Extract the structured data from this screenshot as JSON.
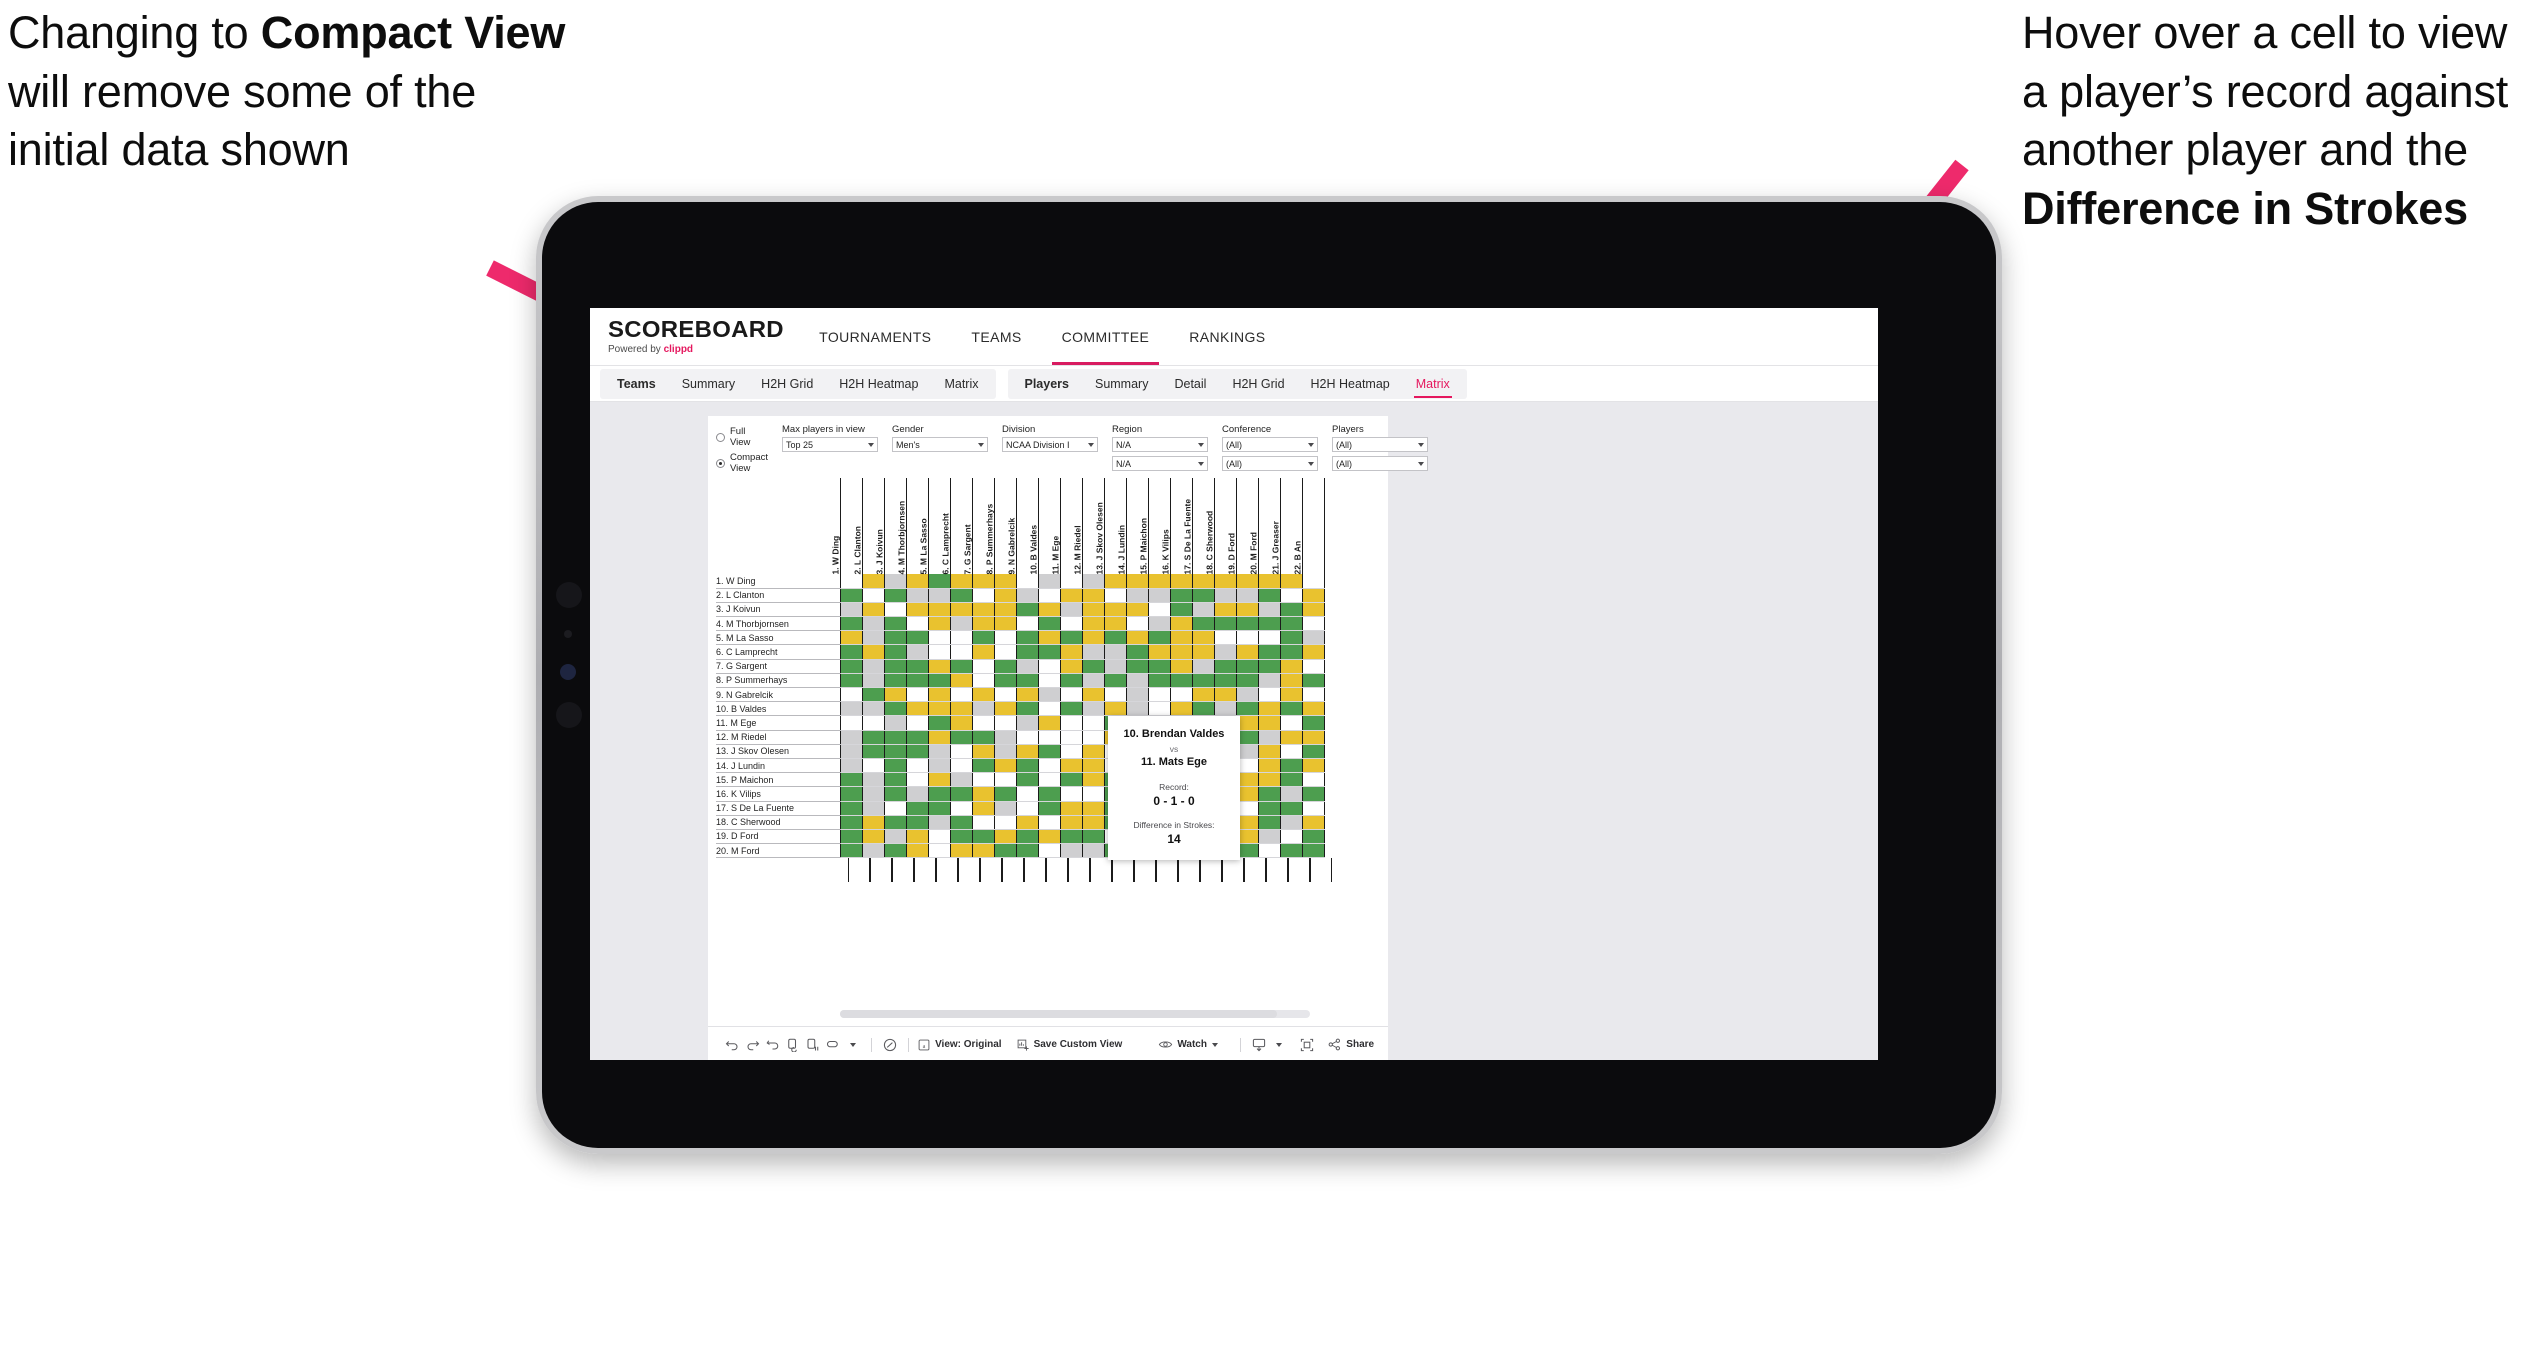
{
  "annotations": {
    "left": {
      "pre": "Changing to ",
      "bold": "Compact View",
      "post": " will remove some of the initial data shown"
    },
    "right": {
      "pre": "Hover over a cell to view a player’s record against another player and the ",
      "bold": "Difference in Strokes",
      "post": ""
    },
    "arrow_color": "#ee2a6c"
  },
  "brand": {
    "name": "SCOREBOARD",
    "powered_prefix": "Powered by ",
    "powered_name": "clippd"
  },
  "topnav": {
    "items": [
      {
        "label": "TOURNAMENTS",
        "active": false
      },
      {
        "label": "TEAMS",
        "active": false
      },
      {
        "label": "COMMITTEE",
        "active": true
      },
      {
        "label": "RANKINGS",
        "active": false
      }
    ]
  },
  "tabstrip": {
    "groups": [
      {
        "label": "Teams",
        "tabs": [
          "Summary",
          "H2H Grid",
          "H2H Heatmap",
          "Matrix"
        ],
        "selected": ""
      },
      {
        "label": "Players",
        "tabs": [
          "Summary",
          "Detail",
          "H2H Grid",
          "H2H Heatmap",
          "Matrix"
        ],
        "selected": "Matrix"
      }
    ]
  },
  "filters": {
    "view_mode": {
      "options": [
        "Full View",
        "Compact View"
      ],
      "selected": "Compact View"
    },
    "fields": [
      {
        "label": "Max players in view",
        "values": [
          "Top 25"
        ]
      },
      {
        "label": "Gender",
        "values": [
          "Men's"
        ]
      },
      {
        "label": "Division",
        "values": [
          "NCAA Division I"
        ]
      },
      {
        "label": "Region",
        "values": [
          "N/A",
          "N/A"
        ]
      },
      {
        "label": "Conference",
        "values": [
          "(All)",
          "(All)"
        ]
      },
      {
        "label": "Players",
        "values": [
          "(All)",
          "(All)"
        ]
      }
    ]
  },
  "matrix": {
    "columns": [
      "1. W Ding",
      "2. L Clanton",
      "3. J Koivun",
      "4. M Thorbjornsen",
      "5. M La Sasso",
      "6. C Lamprecht",
      "7. G Sargent",
      "8. P Summerhays",
      "9. N Gabrelcik",
      "10. B Valdes",
      "11. M Ege",
      "12. M Riedel",
      "13. J Skov Olesen",
      "14. J Lundin",
      "15. P Maichon",
      "16. K Vilips",
      "17. S De La Fuente",
      "18. C Sherwood",
      "19. D Ford",
      "20. M Ford",
      "21. J Greaser",
      "22. B An"
    ],
    "rows": [
      "1. W Ding",
      "2. L Clanton",
      "3. J Koivun",
      "4. M Thorbjornsen",
      "5. M La Sasso",
      "6. C Lamprecht",
      "7. G Sargent",
      "8. P Summerhays",
      "9. N Gabrelcik",
      "10. B Valdes",
      "11. M Ege",
      "12. M Riedel",
      "13. J Skov Olesen",
      "14. J Lundin",
      "15. P Maichon",
      "16. K Vilips",
      "17. S De La Fuente",
      "18. C Sherwood",
      "19. D Ford",
      "20. M Ford"
    ],
    "legend": {
      "win": "#4d9e4f",
      "tie": "#e9c22f",
      "loss": "#cfcfd1",
      "none": "#ffffff"
    },
    "cells": [
      [
        "w",
        "y",
        "a",
        "y",
        "g",
        "y",
        "y",
        "y",
        "w",
        "a",
        "w",
        "a",
        "y",
        "y",
        "y",
        "y",
        "y",
        "y",
        "y",
        "y",
        "y",
        "w"
      ],
      [
        "g",
        "w",
        "g",
        "a",
        "a",
        "g",
        "w",
        "y",
        "a",
        "w",
        "y",
        "y",
        "w",
        "a",
        "a",
        "g",
        "g",
        "a",
        "a",
        "g",
        "w",
        "y"
      ],
      [
        "a",
        "y",
        "w",
        "y",
        "y",
        "y",
        "y",
        "y",
        "g",
        "y",
        "a",
        "y",
        "y",
        "y",
        "w",
        "g",
        "a",
        "y",
        "y",
        "a",
        "g",
        "y"
      ],
      [
        "g",
        "a",
        "g",
        "w",
        "y",
        "a",
        "y",
        "y",
        "w",
        "g",
        "w",
        "y",
        "y",
        "w",
        "a",
        "y",
        "g",
        "g",
        "g",
        "g",
        "g",
        "w"
      ],
      [
        "y",
        "a",
        "g",
        "g",
        "w",
        "w",
        "g",
        "w",
        "g",
        "y",
        "g",
        "y",
        "g",
        "y",
        "g",
        "y",
        "y",
        "w",
        "w",
        "w",
        "g",
        "a"
      ],
      [
        "g",
        "y",
        "g",
        "a",
        "w",
        "w",
        "y",
        "w",
        "g",
        "g",
        "y",
        "a",
        "a",
        "g",
        "y",
        "y",
        "y",
        "a",
        "y",
        "g",
        "g",
        "y"
      ],
      [
        "g",
        "a",
        "g",
        "g",
        "y",
        "g",
        "w",
        "g",
        "a",
        "w",
        "y",
        "g",
        "a",
        "g",
        "g",
        "y",
        "a",
        "g",
        "g",
        "g",
        "y",
        "w"
      ],
      [
        "g",
        "a",
        "g",
        "g",
        "g",
        "y",
        "w",
        "g",
        "g",
        "w",
        "g",
        "a",
        "g",
        "a",
        "g",
        "g",
        "g",
        "g",
        "g",
        "a",
        "y",
        "g"
      ],
      [
        "w",
        "g",
        "y",
        "w",
        "y",
        "w",
        "y",
        "w",
        "y",
        "a",
        "w",
        "y",
        "w",
        "a",
        "w",
        "w",
        "y",
        "y",
        "a",
        "w",
        "y",
        "w"
      ],
      [
        "a",
        "a",
        "g",
        "y",
        "y",
        "y",
        "a",
        "y",
        "g",
        "w",
        "g",
        "a",
        "y",
        "a",
        "w",
        "y",
        "g",
        "a",
        "g",
        "y",
        "g",
        "y"
      ],
      [
        "w",
        "w",
        "a",
        "w",
        "g",
        "y",
        "w",
        "w",
        "a",
        "y",
        "w",
        "w",
        "g",
        "w",
        "a",
        "a",
        "w",
        "y",
        "y",
        "y",
        "w",
        "g"
      ],
      [
        "a",
        "g",
        "g",
        "g",
        "y",
        "g",
        "g",
        "a",
        "w",
        "w",
        "w",
        "w",
        "y",
        "w",
        "g",
        "a",
        "w",
        "a",
        "g",
        "a",
        "y",
        "y"
      ],
      [
        "a",
        "g",
        "g",
        "g",
        "a",
        "w",
        "y",
        "a",
        "y",
        "g",
        "w",
        "y",
        "w",
        "y",
        "a",
        "y",
        "y",
        "y",
        "a",
        "y",
        "w",
        "g"
      ],
      [
        "a",
        "w",
        "g",
        "w",
        "a",
        "w",
        "g",
        "y",
        "g",
        "w",
        "y",
        "y",
        "w",
        "w",
        "g",
        "a",
        "g",
        "w",
        "w",
        "y",
        "g",
        "y"
      ],
      [
        "g",
        "a",
        "g",
        "w",
        "y",
        "a",
        "w",
        "w",
        "g",
        "w",
        "g",
        "y",
        "g",
        "w",
        "w",
        "g",
        "w",
        "y",
        "y",
        "y",
        "g",
        "w"
      ],
      [
        "g",
        "a",
        "g",
        "a",
        "g",
        "g",
        "y",
        "g",
        "w",
        "g",
        "w",
        "w",
        "g",
        "a",
        "g",
        "g",
        "a",
        "w",
        "y",
        "g",
        "a",
        "g"
      ],
      [
        "g",
        "a",
        "w",
        "g",
        "g",
        "w",
        "y",
        "a",
        "w",
        "g",
        "y",
        "y",
        "g",
        "g",
        "g",
        "w",
        "g",
        "w",
        "w",
        "g",
        "g",
        "w"
      ],
      [
        "g",
        "y",
        "g",
        "g",
        "a",
        "g",
        "w",
        "w",
        "y",
        "w",
        "y",
        "y",
        "g",
        "y",
        "w",
        "g",
        "y",
        "y",
        "y",
        "g",
        "a",
        "y"
      ],
      [
        "g",
        "y",
        "a",
        "y",
        "w",
        "g",
        "g",
        "y",
        "g",
        "y",
        "g",
        "g",
        "w",
        "w",
        "y",
        "w",
        "g",
        "y",
        "y",
        "a",
        "w",
        "g"
      ],
      [
        "g",
        "a",
        "g",
        "y",
        "w",
        "y",
        "y",
        "g",
        "g",
        "w",
        "a",
        "a",
        "g",
        "g",
        "y",
        "w",
        "g",
        "y",
        "g",
        "w",
        "g",
        "g"
      ]
    ]
  },
  "tooltip": {
    "player_a": "10. Brendan Valdes",
    "vs": "vs",
    "player_b": "11. Mats Ege",
    "record_label": "Record:",
    "record_value": "0 - 1 - 0",
    "strokes_label": "Difference in Strokes:",
    "strokes_value": "14"
  },
  "bottombar": {
    "icons": [
      "undo-icon",
      "redo-icon",
      "revert-icon",
      "refresh-icon",
      "pause-icon",
      "pill-icon"
    ],
    "view_label": "View: Original",
    "save_label": "Save Custom View",
    "watch_label": "Watch",
    "share_label": "Share"
  }
}
